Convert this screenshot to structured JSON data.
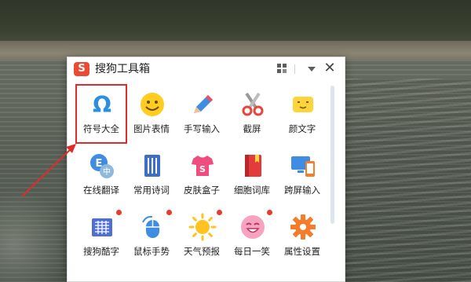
{
  "window": {
    "title": "搜狗工具箱",
    "logo_letter": "S"
  },
  "titlebar": {
    "grid_icon": "grid-icon",
    "dropdown_icon": "chevron-down-icon",
    "close_label": "✕"
  },
  "tools": [
    {
      "label": "符号大全",
      "icon": "omega-icon",
      "selected": true
    },
    {
      "label": "图片表情",
      "icon": "smiley-face-icon"
    },
    {
      "label": "手写输入",
      "icon": "pencil-icon"
    },
    {
      "label": "截屏",
      "icon": "scissors-icon"
    },
    {
      "label": "颜文字",
      "icon": "kaomoji-face-icon"
    },
    {
      "label": "在线翻译",
      "icon": "translate-icon"
    },
    {
      "label": "常用诗词",
      "icon": "poetry-book-icon"
    },
    {
      "label": "皮肤盒子",
      "icon": "tshirt-icon"
    },
    {
      "label": "细胞词库",
      "icon": "dictionary-book-icon"
    },
    {
      "label": "跨屏输入",
      "icon": "cross-screen-icon"
    },
    {
      "label": "搜狗酷字",
      "icon": "cool-font-icon",
      "badge": true
    },
    {
      "label": "鼠标手势",
      "icon": "mouse-gesture-icon",
      "badge": true
    },
    {
      "label": "天气预报",
      "icon": "sun-icon",
      "badge": true
    },
    {
      "label": "每日一笑",
      "icon": "laugh-face-icon",
      "badge": true
    },
    {
      "label": "属性设置",
      "icon": "settings-gear-icon"
    }
  ],
  "colors": {
    "highlight": "#e02b2b",
    "badge": "#ea3b2f",
    "brand": "#e94b35"
  }
}
